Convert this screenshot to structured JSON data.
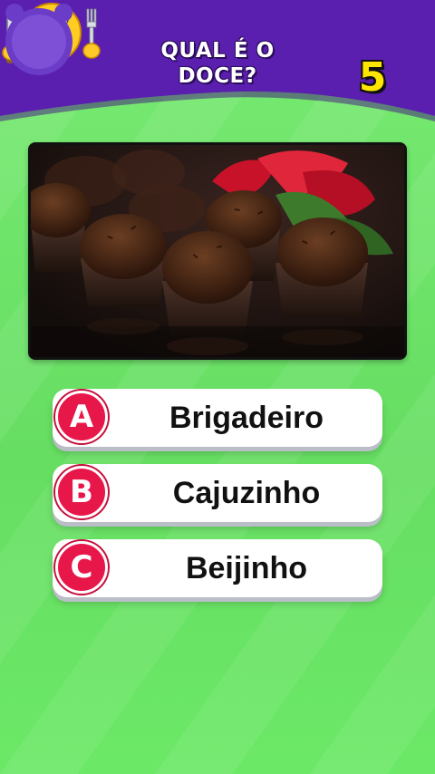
{
  "header": {
    "title_line1": "QUAL É O",
    "title_line2": "DOCE?",
    "timer_value": "5",
    "mascot_icon": "hungry-smiley-with-fork-and-knife-icon",
    "timer_icon": "alarm-clock-icon"
  },
  "question_image": {
    "icon": "brigadeiro-photo"
  },
  "options": [
    {
      "letter": "A",
      "label": "Brigadeiro"
    },
    {
      "letter": "B",
      "label": "Cajuzinho"
    },
    {
      "letter": "C",
      "label": "Beijinho"
    }
  ],
  "colors": {
    "header_purple": "#5a1fae",
    "background_green": "#6fe36a",
    "badge_red": "#e8174a",
    "timer_yellow": "#ffe600"
  }
}
